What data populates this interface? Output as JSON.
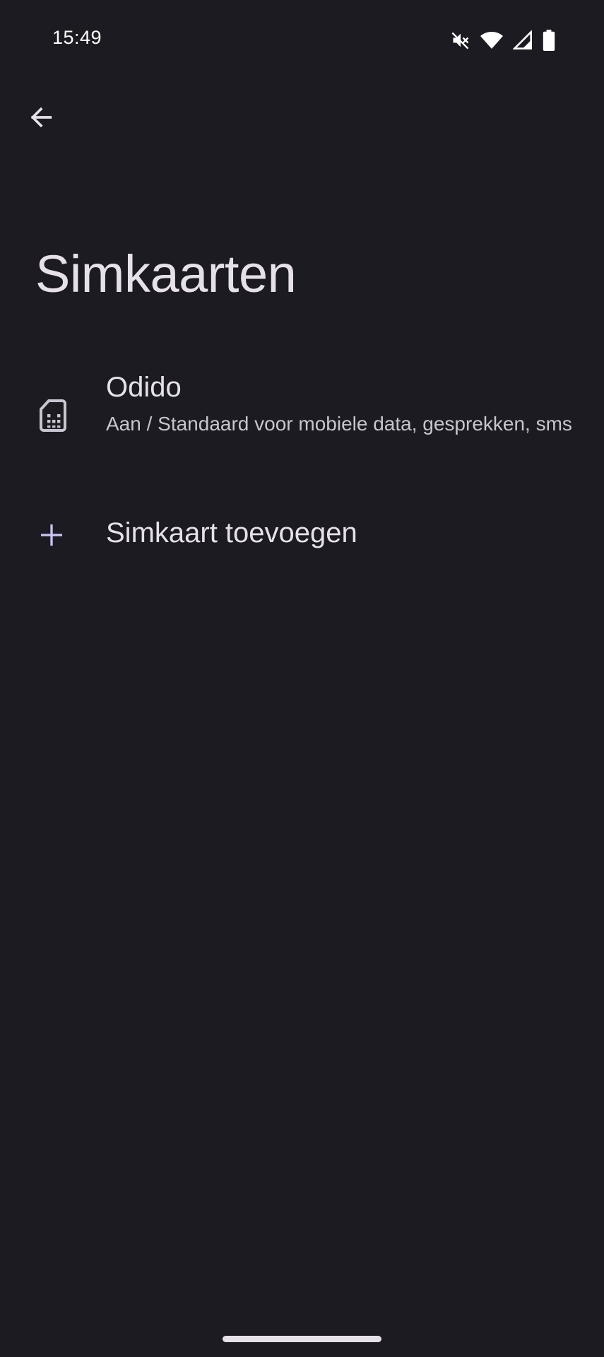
{
  "status_bar": {
    "time": "15:49",
    "icons": [
      "mute-icon",
      "wifi-icon",
      "cell-signal-icon",
      "battery-icon"
    ]
  },
  "header": {
    "back_icon": "arrow-back-icon",
    "title": "Simkaarten"
  },
  "sim_list": {
    "items": [
      {
        "icon": "sim-card-icon",
        "title": "Odido",
        "summary": "Aan / Standaard voor mobiele data, gesprekken, sms"
      }
    ],
    "add": {
      "icon": "plus-icon",
      "label": "Simkaart toevoegen"
    }
  },
  "colors": {
    "background": "#1c1b21",
    "primary_text": "#e6e1e9",
    "secondary_text": "#c9c5d0",
    "accent_icon": "#cdc3f7"
  }
}
